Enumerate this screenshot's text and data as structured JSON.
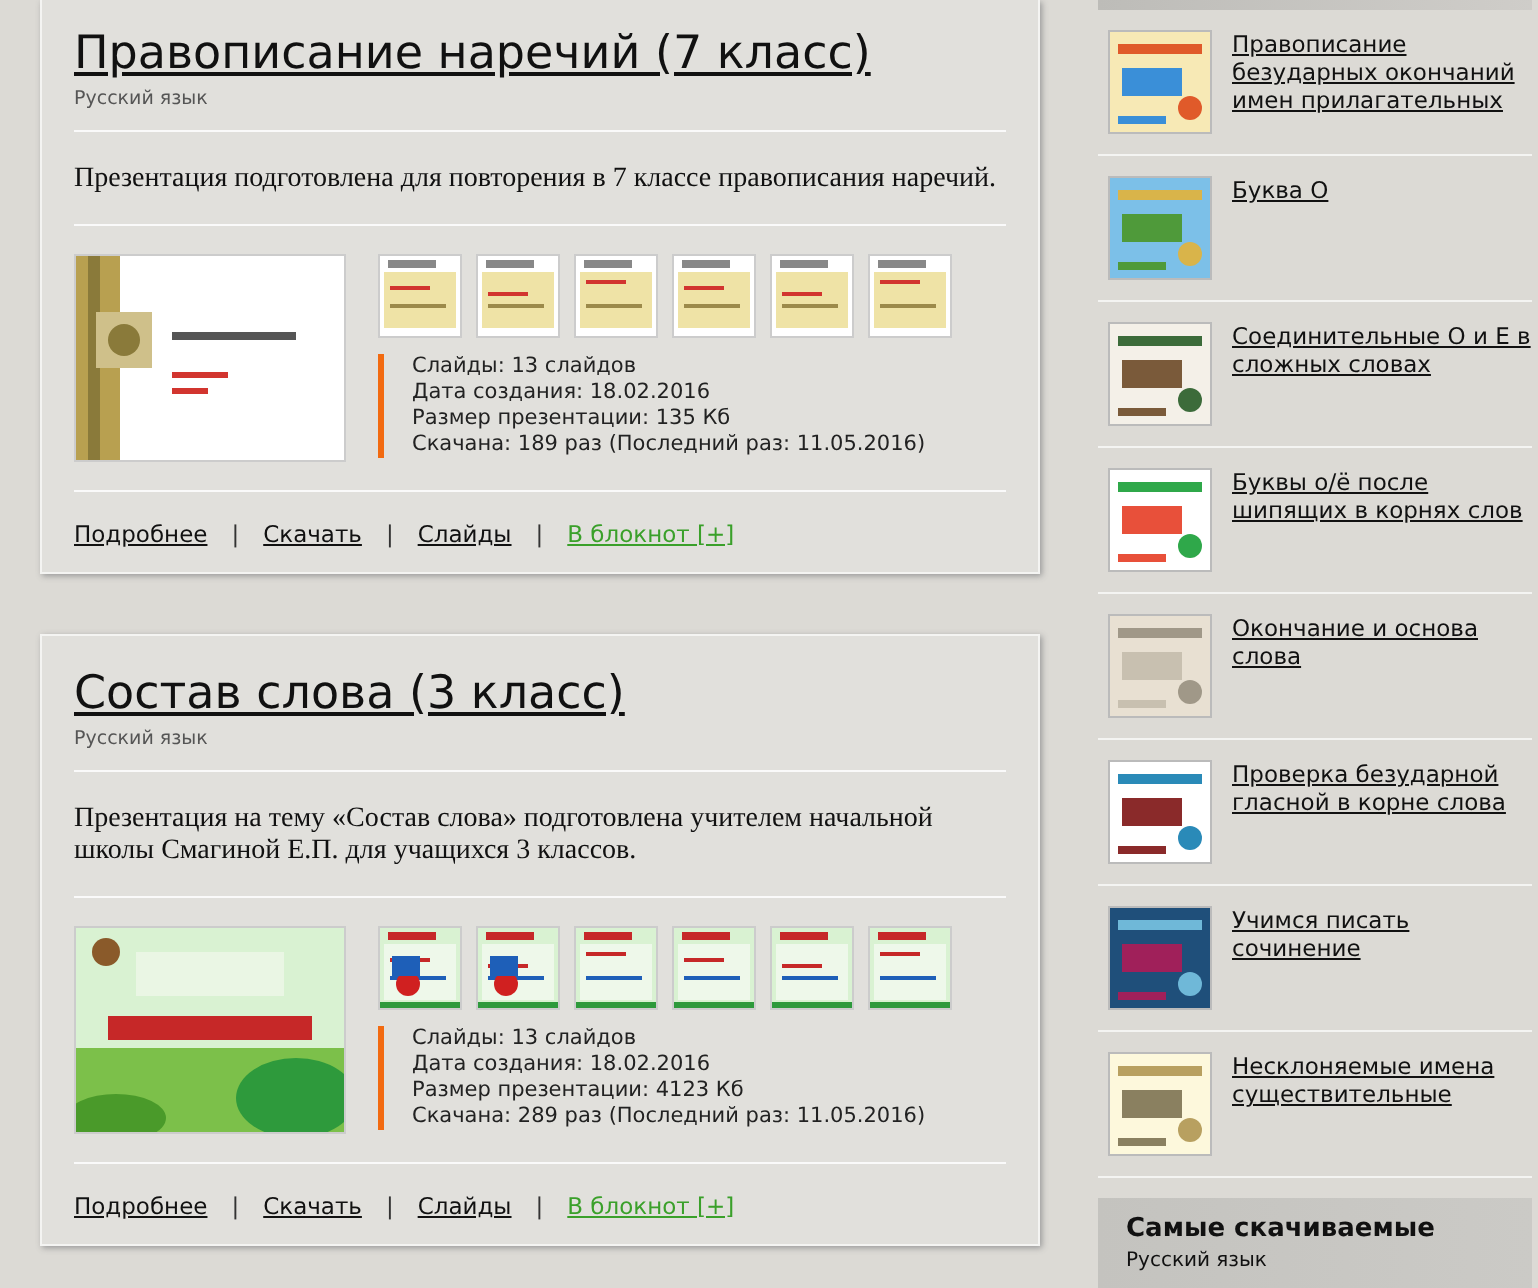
{
  "articles": [
    {
      "title": "Правописание наречий (7 класс)",
      "subject": "Русский язык",
      "description": "Презентация подготовлена для повторения в 7 классе правописания наречий.",
      "stats": [
        "Слайды: 13 слайдов",
        "Дата создания: 18.02.2016",
        "Размер презентации: 135 Кб",
        "Скачана: 189 раз (Последний раз: 11.05.2016)"
      ],
      "links": [
        {
          "label": "Подробнее",
          "kind": "link"
        },
        {
          "label": "Скачать",
          "kind": "link"
        },
        {
          "label": "Слайды",
          "kind": "link"
        },
        {
          "label": "В блокнот [+]",
          "kind": "notebook"
        }
      ]
    },
    {
      "title": "Состав слова (3 класс)",
      "subject": "Русский язык",
      "description": "Презентация на тему «Состав слова» подготовлена учителем начальной школы Смагиной Е.П. для учащихся 3 классов.",
      "stats": [
        "Слайды: 13 слайдов",
        "Дата создания: 18.02.2016",
        "Размер презентации: 4123 Кб",
        "Скачана: 289 раз (Последний раз: 11.05.2016)"
      ],
      "links": [
        {
          "label": "Подробнее",
          "kind": "link"
        },
        {
          "label": "Скачать",
          "kind": "link"
        },
        {
          "label": "Слайды",
          "kind": "link"
        },
        {
          "label": "В блокнот [+]",
          "kind": "notebook"
        }
      ]
    }
  ],
  "separator": "|",
  "sidebar": {
    "items": [
      {
        "title": "Правописание безударных окончаний имен прилагательных"
      },
      {
        "title": "Буква О"
      },
      {
        "title": "Соединительные О и Е в сложных словах"
      },
      {
        "title": "Буквы о/ё после шипящих в корнях слов"
      },
      {
        "title": "Окончание и основа слова"
      },
      {
        "title": "Проверка безударной гласной в корне слова"
      },
      {
        "title": "Учимся писать сочинение"
      },
      {
        "title": "Несклоняемые имена существительные"
      }
    ],
    "top_downloads": {
      "title": "Самые скачиваемые",
      "items": [
        "Русский язык"
      ]
    }
  }
}
